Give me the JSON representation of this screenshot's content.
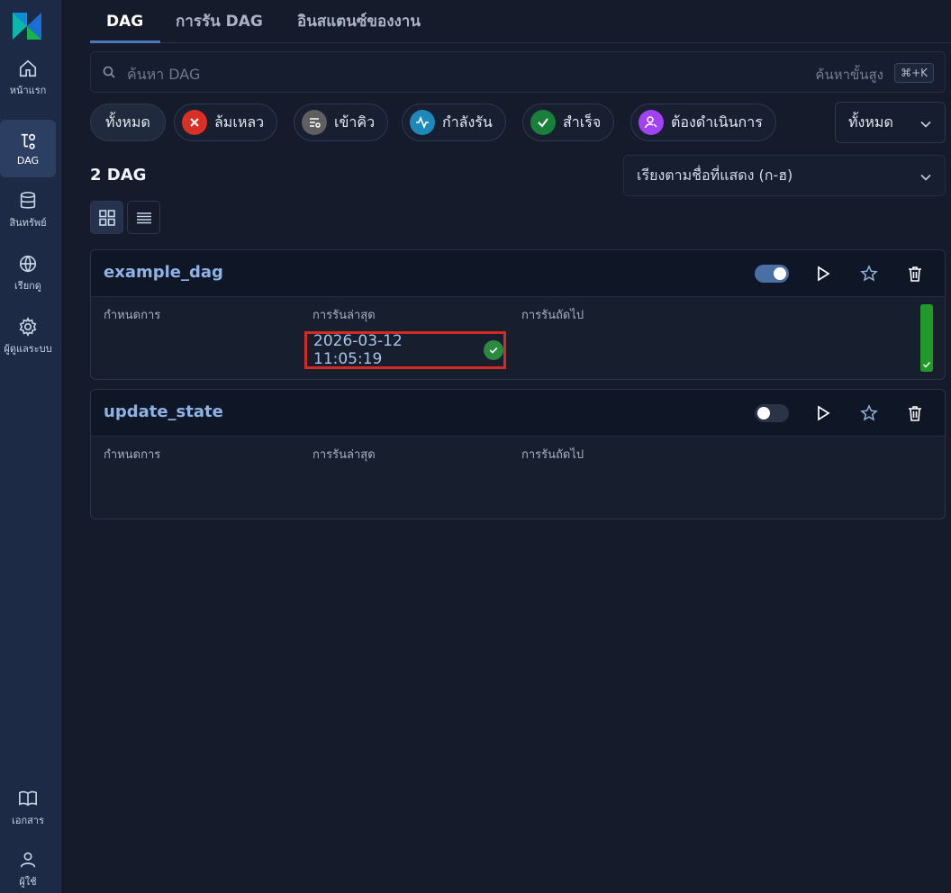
{
  "sidebar": {
    "items": [
      {
        "label": "หน้าแรก",
        "icon": "home-icon"
      },
      {
        "label": "DAG",
        "icon": "dag-icon",
        "active": true
      },
      {
        "label": "สินทรัพย์",
        "icon": "database-icon"
      },
      {
        "label": "เรียกดู",
        "icon": "globe-icon"
      },
      {
        "label": "ผู้ดูแลระบบ",
        "icon": "gear-icon"
      }
    ],
    "bottom_items": [
      {
        "label": "เอกสาร",
        "icon": "book-icon"
      },
      {
        "label": "ผู้ใช้",
        "icon": "user-icon"
      }
    ]
  },
  "tabs": [
    {
      "label": "DAG",
      "active": true
    },
    {
      "label": "การรัน DAG"
    },
    {
      "label": "อินสแตนซ์ของงาน"
    }
  ],
  "search": {
    "placeholder": "ค้นหา DAG",
    "advanced_label": "ค้นหาขั้นสูง",
    "shortcut": "⌘+K"
  },
  "filters": {
    "all_label": "ทั้งหมด",
    "chips": [
      {
        "label": "ล้มเหลว",
        "icon": "x-icon",
        "color": "#d93025"
      },
      {
        "label": "เข้าคิว",
        "icon": "queue-icon",
        "color": "#6b6b6b"
      },
      {
        "label": "กำลังรัน",
        "icon": "activity-icon",
        "color": "#1e88b8"
      },
      {
        "label": "สำเร็จ",
        "icon": "check-icon",
        "color": "#188038"
      },
      {
        "label": "ต้องดำเนินการ",
        "icon": "user-action-icon",
        "color": "#a142f4"
      }
    ],
    "select_value": "ทั้งหมด"
  },
  "count_label": "2 DAG",
  "sort": {
    "value": "เรียงตามชื่อที่แสดง (ก-ฮ)"
  },
  "columns": {
    "schedule": "กำหนดการ",
    "latest_run": "การรันล่าสุด",
    "next_run": "การรันถัดไป"
  },
  "dags": [
    {
      "name": "example_dag",
      "enabled": true,
      "latest_run": "2026-03-12 11:05:19",
      "latest_status": "success",
      "run_bar_fraction": 1.0
    },
    {
      "name": "update_state",
      "enabled": false,
      "latest_run": "",
      "latest_status": ""
    }
  ],
  "colors": {
    "sidebar_bg": "#1d2a45",
    "toggle_on": "#4a6fa5",
    "toggle_off": "#2a3446",
    "highlight": "#d42a22",
    "success": "#2a8a3e"
  }
}
